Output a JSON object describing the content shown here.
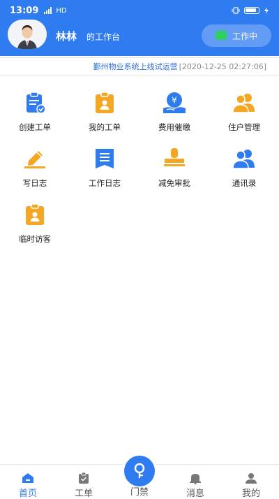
{
  "status_bar": {
    "time": "13:09",
    "network": "HD"
  },
  "header": {
    "user_name": "林林",
    "workbench_label": "的工作台",
    "work_status": "工作中"
  },
  "notice": {
    "message": "鄞州物业系统上线试运营",
    "time": "[2020-12-25 02:27:06]"
  },
  "grid": {
    "items": [
      {
        "label": "创建工单",
        "icon": "create-order-icon"
      },
      {
        "label": "我的工单",
        "icon": "my-order-icon"
      },
      {
        "label": "费用催缴",
        "icon": "fee-collection-icon"
      },
      {
        "label": "住户管理",
        "icon": "resident-management-icon"
      },
      {
        "label": "写日志",
        "icon": "write-log-icon"
      },
      {
        "label": "工作日志",
        "icon": "work-log-icon"
      },
      {
        "label": "减免审批",
        "icon": "approval-stamp-icon"
      },
      {
        "label": "通讯录",
        "icon": "contacts-icon"
      },
      {
        "label": "临时访客",
        "icon": "temporary-visitor-icon"
      }
    ]
  },
  "bottom_nav": {
    "items": [
      {
        "label": "首页",
        "active": true
      },
      {
        "label": "工单",
        "active": false
      },
      {
        "label": "门禁",
        "active": false
      },
      {
        "label": "消息",
        "active": false
      },
      {
        "label": "我的",
        "active": false
      }
    ]
  },
  "colors": {
    "primary": "#2f7bf0",
    "accent_orange": "#f5a623",
    "status_green": "#2ed15b"
  }
}
